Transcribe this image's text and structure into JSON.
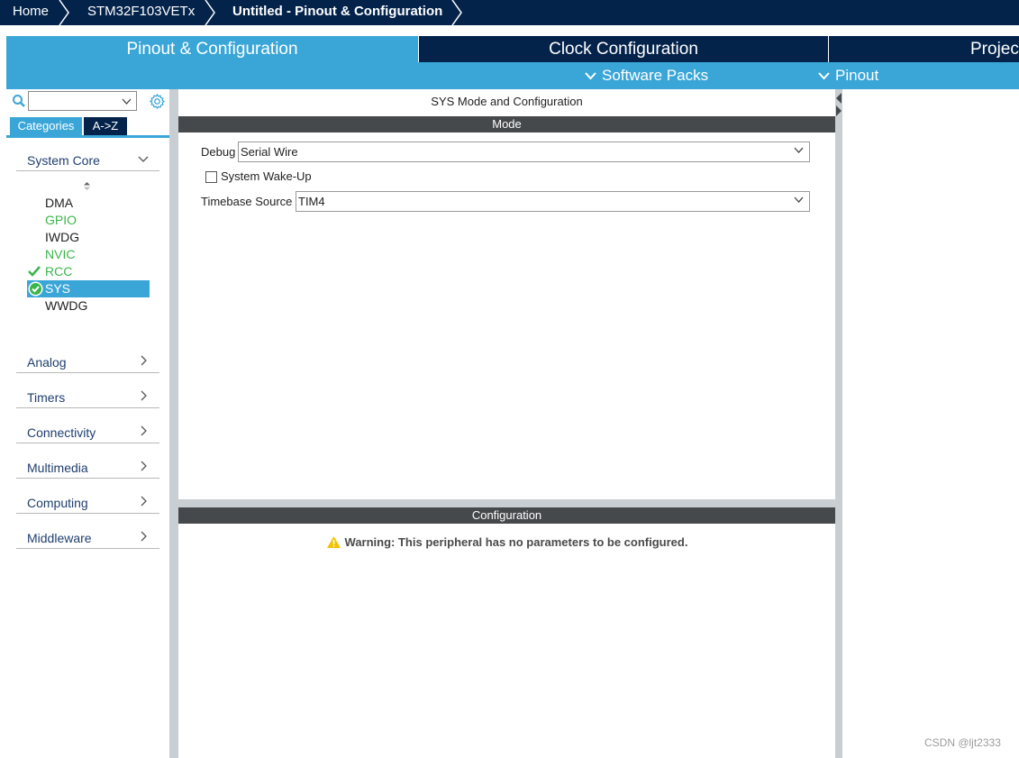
{
  "breadcrumb": {
    "home": "Home",
    "device": "STM32F103VETx",
    "current": "Untitled - Pinout & Configuration"
  },
  "tabs": {
    "pinout": "Pinout & Configuration",
    "clock": "Clock Configuration",
    "project": "Projec"
  },
  "subbar": {
    "software_packs": "Software Packs",
    "pinout": "Pinout"
  },
  "left": {
    "search_value": "",
    "tab_categories": "Categories",
    "tab_az": "A->Z",
    "system_core": "System Core",
    "peripherals": [
      {
        "label": "DMA",
        "status": "none"
      },
      {
        "label": "GPIO",
        "status": "configured"
      },
      {
        "label": "IWDG",
        "status": "none"
      },
      {
        "label": "NVIC",
        "status": "configured"
      },
      {
        "label": "RCC",
        "status": "checked"
      },
      {
        "label": "SYS",
        "status": "selected"
      },
      {
        "label": "WWDG",
        "status": "none"
      }
    ],
    "categories": [
      "Analog",
      "Timers",
      "Connectivity",
      "Multimedia",
      "Computing",
      "Middleware"
    ]
  },
  "mode_panel": {
    "title": "SYS Mode and Configuration",
    "mode_header": "Mode",
    "debug_label": "Debug",
    "debug_value": "Serial Wire",
    "wakeup_label": "System Wake-Up",
    "wakeup_checked": false,
    "timebase_label": "Timebase Source",
    "timebase_value": "TIM4"
  },
  "config_panel": {
    "header": "Configuration",
    "warning": "Warning: This peripheral has no parameters to be configured."
  },
  "watermark": "CSDN @ljt2333",
  "colors": {
    "navy": "#03234b",
    "accent_blue": "#3aa6d8",
    "green": "#3bb54a",
    "dark_bar": "#46494c",
    "warning_yellow": "#f2c200"
  }
}
